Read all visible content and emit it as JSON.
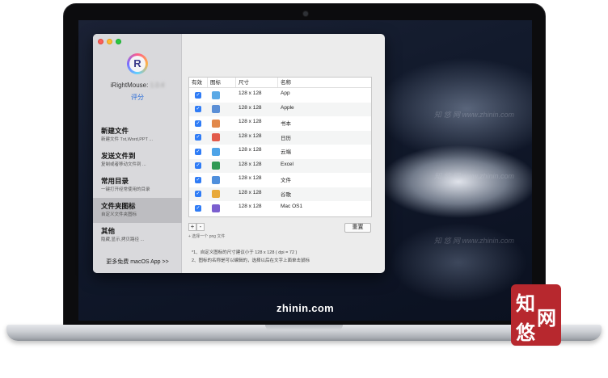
{
  "window": {
    "app_name": "iRightMouse:",
    "app_version_blurred": "1.0.4",
    "rate_label": "评分",
    "logo_letter": "R",
    "more_apps_label": "更多免费 macOS App >>"
  },
  "sidebar": {
    "items": [
      {
        "title": "新建文件",
        "subtitle": "新建文件 Txt,Word,PPT ..."
      },
      {
        "title": "发送文件到",
        "subtitle": "复制或者移动文件到 ..."
      },
      {
        "title": "常用目录",
        "subtitle": "一键打开经常使用的目录"
      },
      {
        "title": "文件夹图标",
        "subtitle": "自定义文件夹图标"
      },
      {
        "title": "其他",
        "subtitle": "隐藏,显示,拷贝路径 ..."
      }
    ],
    "active_index": 3
  },
  "table": {
    "headers": [
      "有效",
      "图标",
      "尺寸",
      "名称"
    ],
    "rows": [
      {
        "size": "128 x 128",
        "name": "App",
        "icon": "app-folder-icon",
        "color": "#5aa9e6"
      },
      {
        "size": "128 x 128",
        "name": "Apple",
        "icon": "apple-folder-icon",
        "color": "#5b8fd6"
      },
      {
        "size": "128 x 128",
        "name": "书本",
        "icon": "book-folder-icon",
        "color": "#e2884a"
      },
      {
        "size": "128 x 128",
        "name": "日历",
        "icon": "calendar-folder-icon",
        "color": "#e25a4a"
      },
      {
        "size": "128 x 128",
        "name": "云端",
        "icon": "cloud-folder-icon",
        "color": "#4da3e8"
      },
      {
        "size": "128 x 128",
        "name": "Excel",
        "icon": "excel-folder-icon",
        "color": "#2f9a55"
      },
      {
        "size": "128 x 128",
        "name": "文件",
        "icon": "file-folder-icon",
        "color": "#4f8fdc"
      },
      {
        "size": "128 x 128",
        "name": "谷歌",
        "icon": "google-folder-icon",
        "color": "#e8a93a"
      },
      {
        "size": "128 x 128",
        "name": "Mac OS1",
        "icon": "macos-folder-icon",
        "color": "#7b5fcf"
      }
    ]
  },
  "toolbar": {
    "add_label": "+",
    "remove_label": "-",
    "hint": "+ 选择一个 png 文件",
    "reset_label": "重置"
  },
  "notes": [
    "*1、自定义图标的尺寸建议小于 128 x 128 ( dpi = 72 )",
    "2、图标的名称是可以编辑的，选择以后在文字上面单击鼠标"
  ],
  "screen": {
    "site_label": "zhinin.com",
    "watermark": "知 悠 网  www.zhinin.com"
  },
  "stamp": {
    "chars": [
      "知",
      "悠",
      "网"
    ]
  },
  "colors": {
    "accent": "#2f7cf6",
    "active_row": "#bdbdc1",
    "stamp": "#b7282e"
  }
}
